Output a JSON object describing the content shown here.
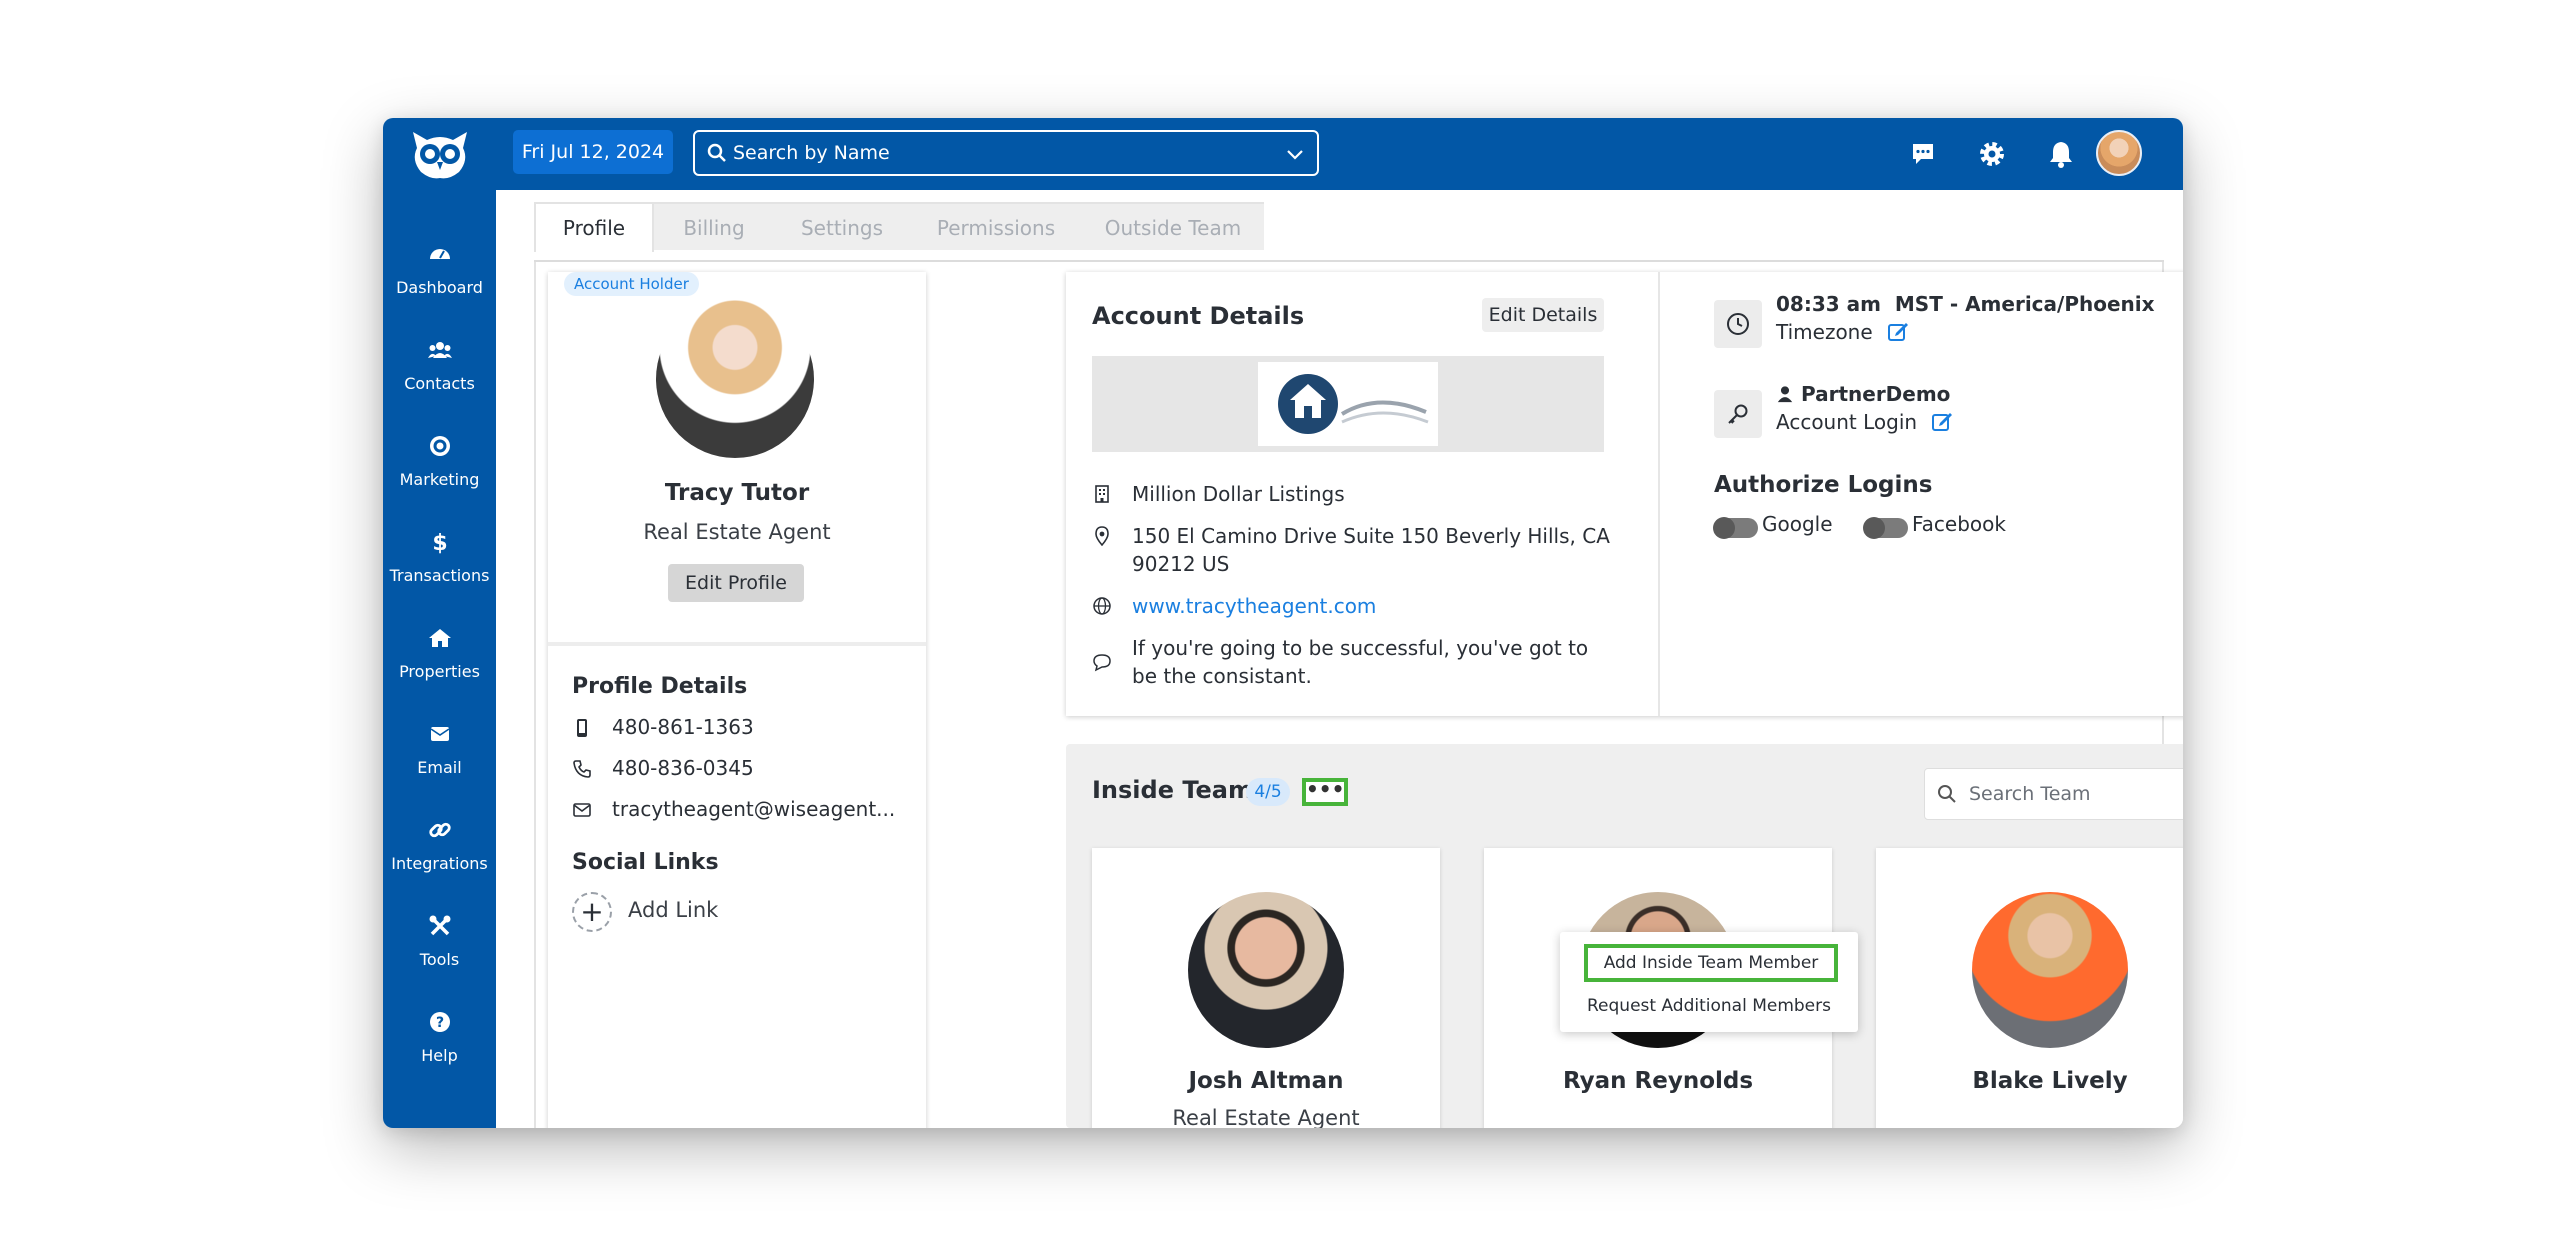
{
  "topbar": {
    "date": "Fri Jul 12, 2024",
    "search_placeholder": "Search by Name",
    "icons": [
      "chat-icon",
      "gear-icon",
      "bell-icon"
    ]
  },
  "sidebar": {
    "items": [
      {
        "label": "Dashboard",
        "icon": "gauge-icon"
      },
      {
        "label": "Contacts",
        "icon": "users-icon"
      },
      {
        "label": "Marketing",
        "icon": "target-icon"
      },
      {
        "label": "Transactions",
        "icon": "dollar-icon"
      },
      {
        "label": "Properties",
        "icon": "home-icon"
      },
      {
        "label": "Email",
        "icon": "envelope-icon"
      },
      {
        "label": "Integrations",
        "icon": "link-icon"
      },
      {
        "label": "Tools",
        "icon": "tools-icon"
      },
      {
        "label": "Help",
        "icon": "help-icon"
      }
    ]
  },
  "tabs": [
    "Profile",
    "Billing",
    "Settings",
    "Permissions",
    "Outside Team"
  ],
  "profile": {
    "badge": "Account Holder",
    "name": "Tracy Tutor",
    "role": "Real Estate Agent",
    "edit_label": "Edit Profile",
    "details_title": "Profile Details",
    "mobile": "480-861-1363",
    "phone": "480-836-0345",
    "email": "tracytheagent@wiseagent...",
    "social_title": "Social Links",
    "add_link": "Add Link"
  },
  "account": {
    "title": "Account Details",
    "edit_label": "Edit Details",
    "company": "Million Dollar Listings",
    "address": "150 El Camino Drive Suite 150 Beverly Hills, CA 90212 US",
    "website": "www.tracytheagent.com",
    "motto": "If you're going to be successful, you've got to be the consistant.",
    "time": "08:33 am",
    "timezone_name": "MST - America/Phoenix",
    "timezone_label": "Timezone",
    "login_user": "PartnerDemo",
    "login_label": "Account Login",
    "authorize_title": "Authorize Logins",
    "google": "Google",
    "facebook": "Facebook"
  },
  "team": {
    "title": "Inside Team",
    "count": "4/5",
    "more": "•••",
    "search_placeholder": "Search Team",
    "members": [
      {
        "name": "Josh Altman",
        "role": "Real Estate Agent"
      },
      {
        "name": "Ryan Reynolds"
      },
      {
        "name": "Blake Lively"
      }
    ],
    "menu": {
      "add": "Add Inside Team Member",
      "request": "Request Additional Members"
    }
  },
  "colors": {
    "brand": "#0257a6",
    "accent": "#1a7fe0",
    "highlight": "#47b43a"
  }
}
